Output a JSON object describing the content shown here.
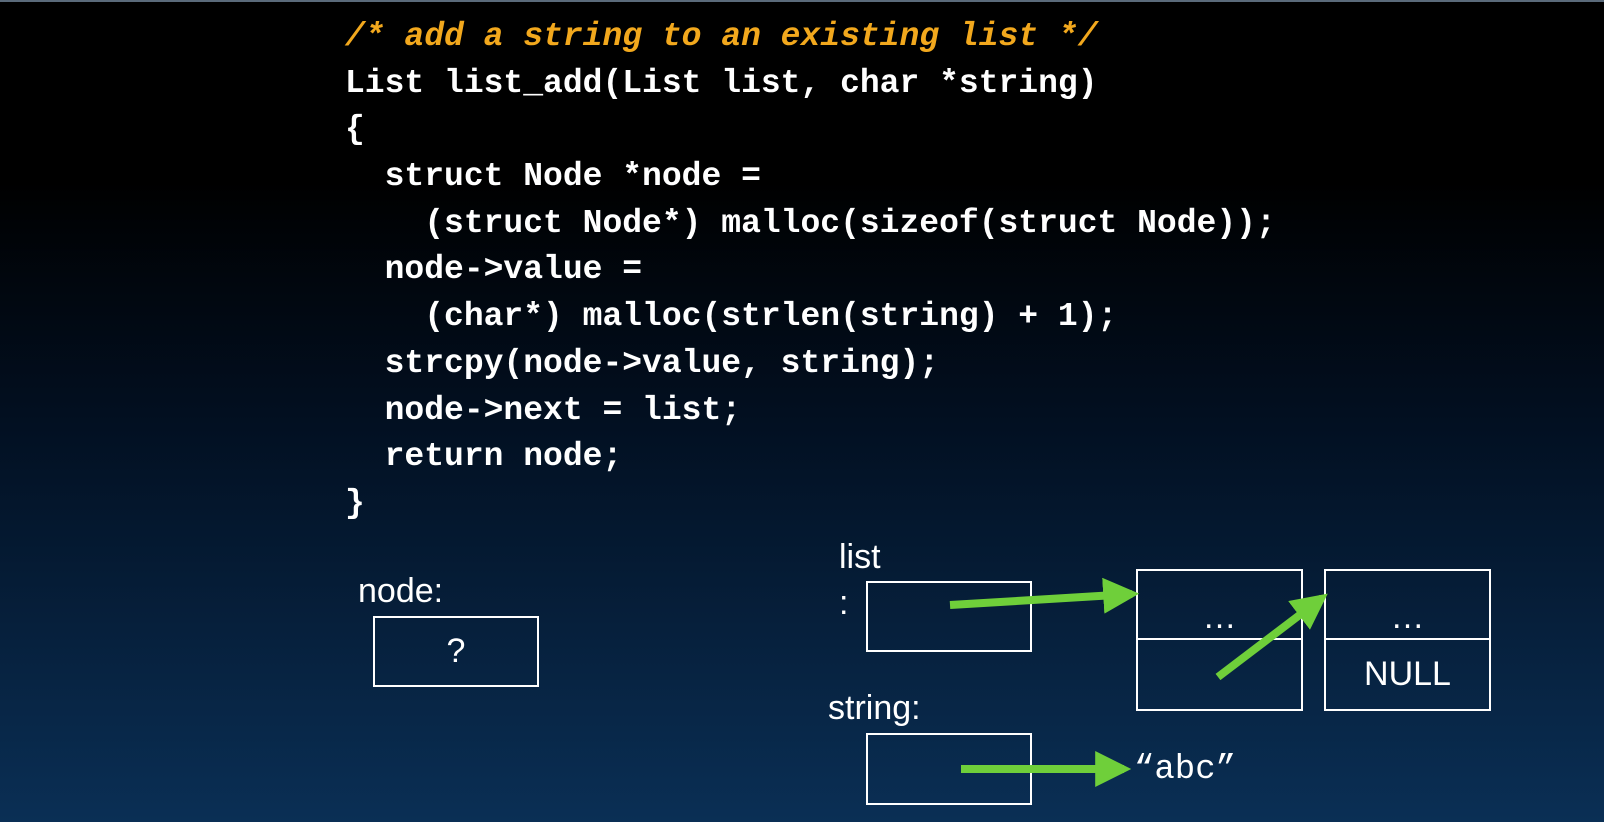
{
  "code": {
    "comment": "/* add a string to an existing list */",
    "lines": [
      "List list_add(List list, char *string)",
      "{",
      "  struct Node *node =",
      "    (struct Node*) malloc(sizeof(struct Node));",
      "  node->value =",
      "    (char*) malloc(strlen(string) + 1);",
      "  strcpy(node->value, string);",
      "  node->next = list;",
      "  return node;",
      "}"
    ]
  },
  "diagram": {
    "node_label": "node:",
    "node_value": "?",
    "list_label": "list",
    "list_label_colon": ":",
    "string_label": "string:",
    "first_node_value": "…",
    "second_node_value": "…",
    "second_node_next": "NULL",
    "string_literal": "“abc”",
    "colors": {
      "arrow": "#6fcf3a",
      "box_border": "#ffffff",
      "comment": "#f2a81d"
    }
  }
}
